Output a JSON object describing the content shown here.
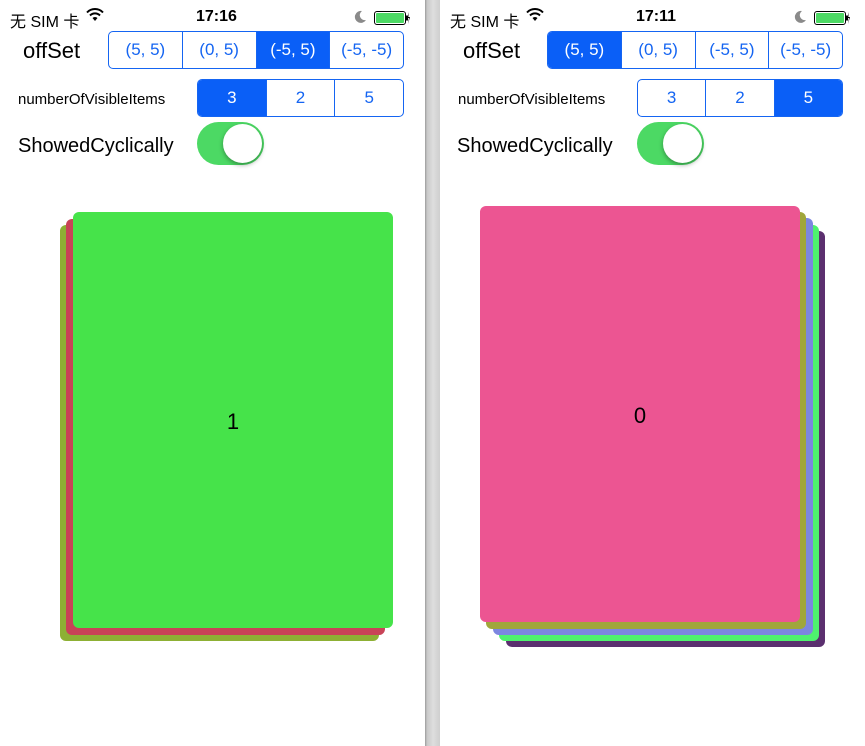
{
  "colors": {
    "accent": "#1565f2",
    "switch_on": "#4cd964",
    "card_green": "#46e34a",
    "card_olive": "#8db034",
    "card_crimson": "#c84357",
    "card_pink": "#ec5592",
    "card_olive2": "#a0a63b",
    "card_periwinkle": "#7c86e0",
    "card_mint": "#4ef26e",
    "card_purple": "#5b2f6f"
  },
  "left": {
    "status": {
      "carrier": "无 SIM 卡",
      "time": "17:16"
    },
    "offset": {
      "label": "offSet",
      "options": [
        "(5, 5)",
        "(0, 5)",
        "(-5, 5)",
        "(-5, -5)"
      ],
      "selected": "(-5, 5)"
    },
    "visible": {
      "label": "numberOfVisibleItems",
      "options": [
        "3",
        "2",
        "5"
      ],
      "selected": "3"
    },
    "cyclic": {
      "label": "ShowedCyclically",
      "on": true
    },
    "top_card_label": "1"
  },
  "right": {
    "status": {
      "carrier": "无 SIM 卡",
      "time": "17:11"
    },
    "offset": {
      "label": "offSet",
      "options": [
        "(5, 5)",
        "(0, 5)",
        "(-5, 5)",
        "(-5, -5)"
      ],
      "selected": "(5, 5)"
    },
    "visible": {
      "label": "numberOfVisibleItems",
      "options": [
        "3",
        "2",
        "5"
      ],
      "selected": "5"
    },
    "cyclic": {
      "label": "ShowedCyclically",
      "on": true
    },
    "top_card_label": "0"
  }
}
